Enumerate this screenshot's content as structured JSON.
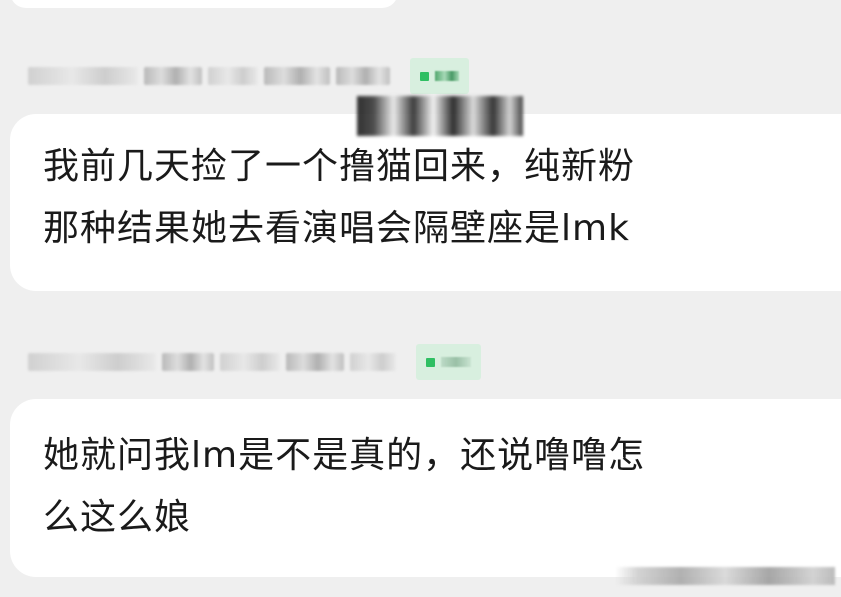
{
  "chat": {
    "messages": [
      {
        "text": "我前几天捡了一个撸猫回来，纯新粉\n那种结果她去看演唱会隔壁座是lmk"
      },
      {
        "text": "她就问我lm是不是真的，还说噜噜怎\n么这么娘"
      }
    ]
  },
  "icons": {
    "badge": "level-badge-icon",
    "watermark": "weibo-watermark-logo"
  },
  "colors": {
    "background": "#efefef",
    "bubble": "#ffffff",
    "text": "#1a1a1a",
    "badge_bg": "#d8efdf",
    "badge_dot": "#2fbf63"
  }
}
